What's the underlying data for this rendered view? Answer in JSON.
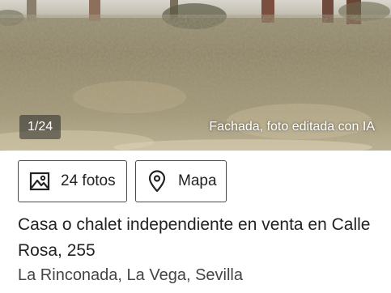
{
  "gallery": {
    "counter": "1/24",
    "caption": "Fachada, foto editada con IA"
  },
  "actions": {
    "photos": {
      "icon": "image-icon",
      "label": "24 fotos"
    },
    "map": {
      "icon": "map-pin-icon",
      "label": "Mapa"
    }
  },
  "listing": {
    "title": "Casa o chalet independiente en venta en Calle Rosa, 255",
    "location": "La Rinconada, La Vega, Sevilla"
  }
}
